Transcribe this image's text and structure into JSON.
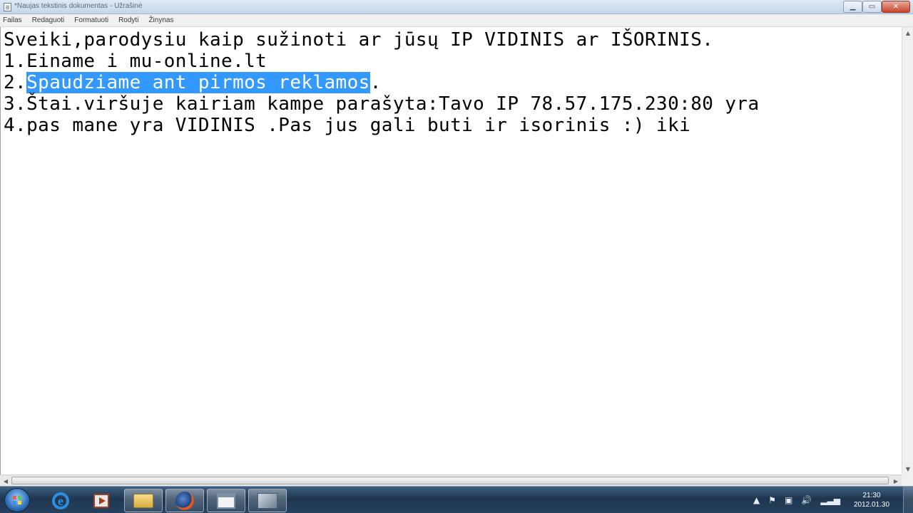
{
  "window": {
    "title": "*Naujas tekstinis dokumentas - Užrašinė",
    "min_symbol": "▁",
    "max_symbol": "▭",
    "close_symbol": "✕"
  },
  "menu": {
    "items": [
      "Failas",
      "Redaguoti",
      "Formatuoti",
      "Rodyti",
      "Žinynas"
    ]
  },
  "document": {
    "line1": "Sveiki,parodysiu kaip sužinoti ar jūsų IP VIDINIS ar IŠORINIS.",
    "line2": "1.Einame i mu-online.lt",
    "line3_prefix": "2.",
    "line3_selected": "Spaudziame ant pirmos reklamos",
    "line3_suffix": ".",
    "line4": "3.Štai.viršuje kairiam kampe parašyta:Tavo IP 78.57.175.230:80 yra",
    "line5": "4.pas mane yra VIDINIS .Pas jus gali buti ir isorinis :) iki",
    "selection_color": "#3399ff"
  },
  "scrollbars": {
    "up": "▲",
    "down": "▼",
    "left": "◀",
    "right": "▶"
  },
  "taskbar": {
    "apps": [
      {
        "name": "internet-explorer-icon"
      },
      {
        "name": "media-player-icon"
      },
      {
        "name": "folder-icon"
      },
      {
        "name": "firefox-icon"
      },
      {
        "name": "window-icon"
      },
      {
        "name": "notepad-icon"
      }
    ],
    "tray": {
      "show_hidden": "▲",
      "flag": "⚑",
      "network": "▣",
      "volume": "🔊",
      "signal": "▂▃▅"
    },
    "clock": {
      "time": "21:30",
      "date": "2012.01.30"
    }
  }
}
